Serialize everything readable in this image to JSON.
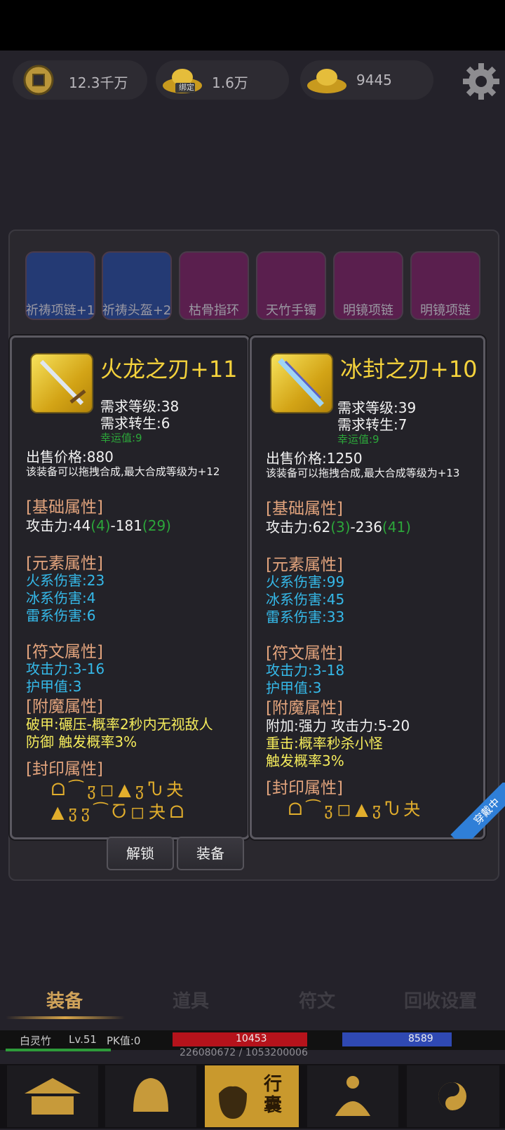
{
  "resources": [
    {
      "icon": "copper-coin-icon",
      "value": "12.3千万"
    },
    {
      "icon": "bound-gold-ingot-icon",
      "value": "1.6万",
      "tag": "绑定"
    },
    {
      "icon": "gold-ingot-icon",
      "value": "9445"
    }
  ],
  "equip_slots": [
    "祈祷项链+1",
    "祈祷头盔+2",
    "枯骨指环",
    "天竹手镯",
    "明镜项链",
    "明镜项链"
  ],
  "left_item": {
    "name": "火龙之刃+11",
    "req_level": "需求等级:38",
    "req_rebirth": "需求转生:6",
    "luck": "幸运值:9",
    "price": "出售价格:880",
    "merge_note": "该装备可以拖拽合成,最大合成等级为+12",
    "base_header": "[基础属性]",
    "atk_label": "攻击力:44",
    "atk_b1": "(4)",
    "atk_mid": "-181",
    "atk_b2": "(29)",
    "elem_header": "[元素属性]",
    "fire": "火系伤害:23",
    "ice": "冰系伤害:4",
    "thunder": "雷系伤害:6",
    "rune_header": "[符文属性]",
    "rune_atk": "攻击力:3-16",
    "rune_armor": "护甲值:3",
    "ench_header": "[附魔属性]",
    "ench1": "破甲:碾压-概率2秒内无视敌人",
    "ench2": "防御  触发概率3%",
    "seal_header": "[封印属性]",
    "seal_row1": "ᗝ⁀ჳ◻▲ჳჀ夬",
    "seal_row2": "▲ჳჳ⁀Ⴀ◻夬ᗝ"
  },
  "right_item": {
    "name": "冰封之刃+10",
    "req_level": "需求等级:39",
    "req_rebirth": "需求转生:7",
    "luck": "幸运值:9",
    "price": "出售价格:1250",
    "merge_note": "该装备可以拖拽合成,最大合成等级为+13",
    "base_header": "[基础属性]",
    "atk_label": "攻击力:62",
    "atk_b1": "(3)",
    "atk_mid": "-236",
    "atk_b2": "(41)",
    "elem_header": "[元素属性]",
    "fire": "火系伤害:99",
    "ice": "冰系伤害:45",
    "thunder": "雷系伤害:33",
    "rune_header": "[符文属性]",
    "rune_atk": "攻击力:3-18",
    "rune_armor": "护甲值:3",
    "ench_header": "[附魔属性]",
    "ench1": "附加:强力 攻击力:5-20",
    "ench2": "重击:概率秒杀小怪",
    "ench3": "触发概率3%",
    "seal_header": "[封印属性]",
    "seal_row1": "ᗝ⁀ჳ◻▲ჳჀ夬",
    "badge": "穿戴中"
  },
  "buttons": {
    "unlock": "解锁",
    "equip": "装备"
  },
  "tabs": [
    "装备",
    "道具",
    "符文",
    "回收设置"
  ],
  "player": {
    "name": "白灵竹",
    "level": "Lv.51",
    "pk": "PK值:0",
    "hp": "10453",
    "mp": "8589",
    "exp": "226080672 / 1053200006"
  },
  "nav": {
    "bag_label": "行囊"
  }
}
